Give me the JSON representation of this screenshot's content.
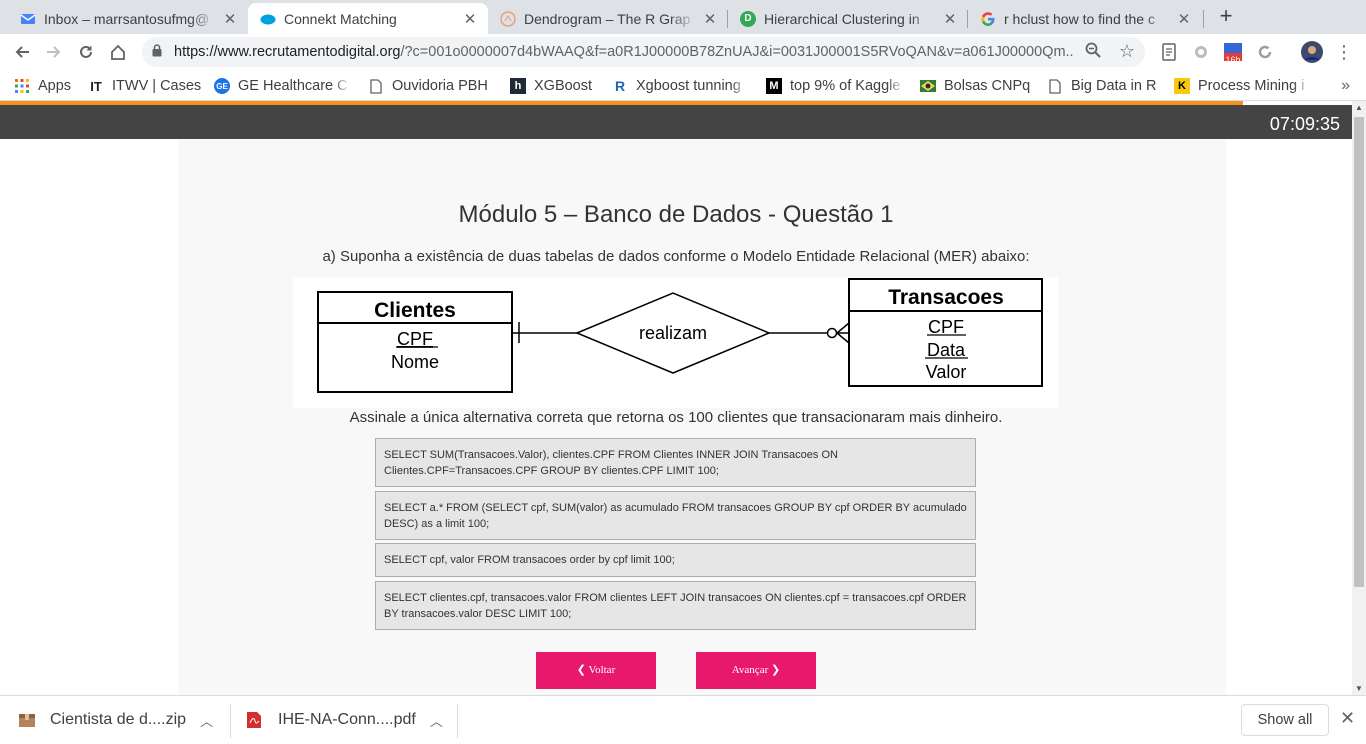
{
  "browser": {
    "tabs": [
      {
        "title": "Inbox – marrsantosufmg@",
        "icon": "mail-icon"
      },
      {
        "title": "Connekt Matching",
        "icon": "salesforce-icon",
        "active": true
      },
      {
        "title": "Dendrogram – The R Grap",
        "icon": "graph-gallery-icon"
      },
      {
        "title": "Hierarchical Clustering in",
        "icon": "d-icon"
      },
      {
        "title": "r hclust how to find the c",
        "icon": "google-icon"
      }
    ],
    "url_host": "https://www.recrutamentodigital.org",
    "url_rest": "/?c=001o0000007d4bWAAQ&f=a0R1J00000B78ZnUAJ&i=0031J00001S5RVoQAN&v=a061J00000Qm...",
    "extension_badge": "16h",
    "bookmarks": [
      {
        "label": "Apps",
        "icon": "apps-grid-icon"
      },
      {
        "label": "ITWV | Cases",
        "icon": "itwv-icon"
      },
      {
        "label": "GE Healthcare C",
        "icon": "ge-icon"
      },
      {
        "label": "Ouvidoria PBH",
        "icon": "page-icon"
      },
      {
        "label": "XGBoost",
        "icon": "h-icon"
      },
      {
        "label": "Xgboost tunning",
        "icon": "r-icon"
      },
      {
        "label": "top 9% of Kaggle",
        "icon": "medium-icon"
      },
      {
        "label": "Bolsas CNPq",
        "icon": "flag-icon"
      },
      {
        "label": "Big Data in R",
        "icon": "page-icon"
      },
      {
        "label": "Process Mining i",
        "icon": "k-icon"
      }
    ],
    "bookmarks_more": "»"
  },
  "page": {
    "timer": "07:09:35",
    "heading": "Módulo 5 – Banco de Dados - Questão 1",
    "question": "a) Suponha a existência de duas tabelas de dados conforme o Modelo Entidade Relacional (MER) abaixo:",
    "diagram": {
      "entity1": {
        "name": "Clientes",
        "attrs": [
          "CPF",
          "Nome"
        ]
      },
      "relationship": "realizam",
      "entity2": {
        "name": "Transacoes",
        "attrs": [
          "CPF",
          "Data",
          "Valor"
        ]
      }
    },
    "instruction": "Assinale a única alternativa correta que retorna os 100 clientes que transacionaram mais dinheiro.",
    "options": [
      "SELECT SUM(Transacoes.Valor), clientes.CPF FROM Clientes INNER JOIN Transacoes ON Clientes.CPF=Transacoes.CPF GROUP BY clientes.CPF LIMIT 100;",
      "SELECT a.* FROM (SELECT cpf, SUM(valor) as acumulado FROM transacoes GROUP BY cpf ORDER BY acumulado DESC) as a limit 100;",
      "SELECT cpf, valor FROM transacoes order by cpf limit 100;",
      "SELECT clientes.cpf, transacoes.valor FROM clientes LEFT JOIN transacoes ON clientes.cpf = transacoes.cpf ORDER BY transacoes.valor DESC LIMIT 100;"
    ],
    "back_label": "Voltar",
    "next_label": "Avançar",
    "accent_color": "#e8186d"
  },
  "downloads": {
    "items": [
      {
        "name": "Cientista de d....zip",
        "icon": "zip-icon"
      },
      {
        "name": "IHE-NA-Conn....pdf",
        "icon": "pdf-icon"
      }
    ],
    "show_all": "Show all"
  }
}
